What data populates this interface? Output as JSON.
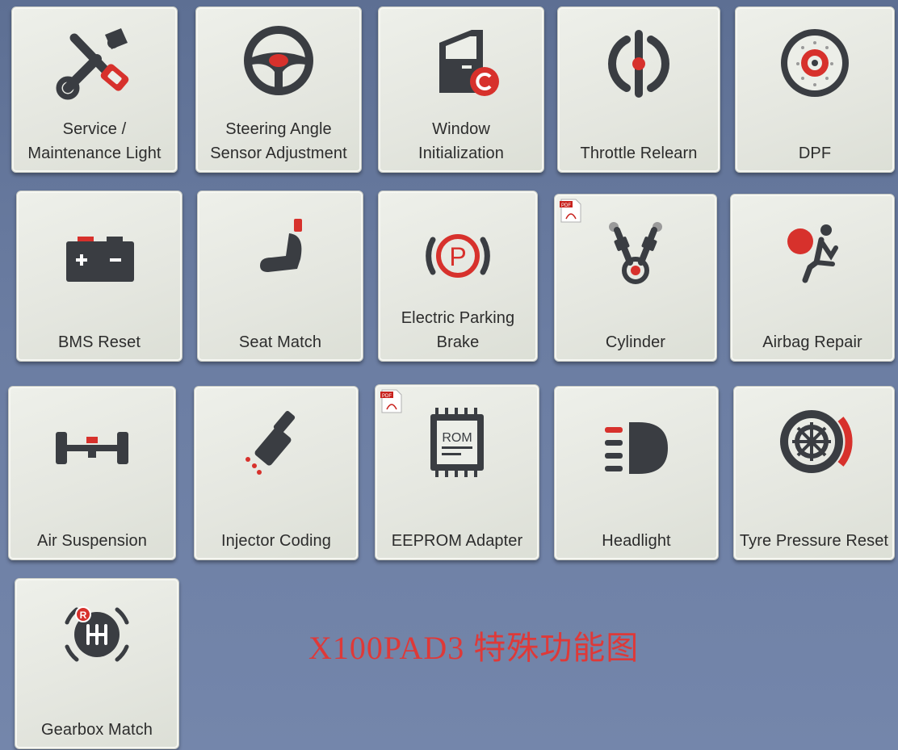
{
  "colors": {
    "icon_dark": "#3a3d42",
    "accent_red": "#d7312c",
    "watermark": "#e8332f"
  },
  "tiles": [
    {
      "label": "Service /\nMaintenance Light",
      "icon": "wrench-screwdriver-icon"
    },
    {
      "label": "Steering Angle\nSensor Adjustment",
      "icon": "steering-wheel-icon"
    },
    {
      "label": "Window\nInitialization",
      "icon": "car-door-window-icon"
    },
    {
      "label": "Throttle Relearn",
      "icon": "throttle-icon"
    },
    {
      "label": "DPF",
      "icon": "particulate-filter-icon"
    },
    {
      "label": "BMS Reset",
      "icon": "battery-icon"
    },
    {
      "label": "Seat Match",
      "icon": "seat-icon"
    },
    {
      "label": "Electric Parking\nBrake",
      "icon": "parking-brake-icon"
    },
    {
      "label": "Cylinder",
      "icon": "cylinder-icon",
      "pdf_badge": "pdf-icon"
    },
    {
      "label": "Airbag Repair",
      "icon": "airbag-icon"
    },
    {
      "label": "Air Suspension",
      "icon": "axle-suspension-icon"
    },
    {
      "label": "Injector Coding",
      "icon": "injector-icon"
    },
    {
      "label": "EEPROM Adapter",
      "icon": "rom-chip-icon",
      "pdf_badge": "pdf-icon",
      "chip_text": "ROM"
    },
    {
      "label": "Headlight",
      "icon": "headlight-icon"
    },
    {
      "label": "Tyre Pressure Reset",
      "icon": "tyre-pressure-icon"
    },
    {
      "label": "Gearbox Match",
      "icon": "gear-shift-icon",
      "gear_text": "R"
    }
  ],
  "watermark": "X100PAD3 特殊功能图",
  "pdf_badge_text": "PDF"
}
